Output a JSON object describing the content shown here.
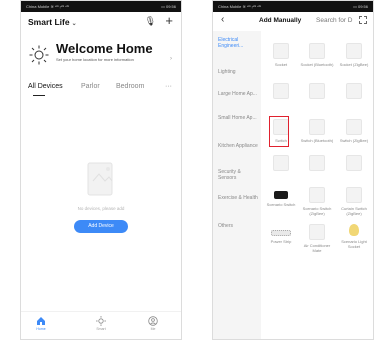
{
  "left_screen": {
    "status": {
      "left": "China Mobile ≋ ⁴ᴳ ᵢ⁴ᴳ ⁴ᴳ",
      "right": "▭ 09:56"
    },
    "home_title": "Smart Life",
    "chevron": "⌄",
    "mic": "🎙",
    "plus": "+",
    "welcome": "Welcome Home",
    "welcome_sub": "Set your home location for more information",
    "welcome_arrow": "›",
    "tabs": [
      "All Devices",
      "Parlor",
      "Bedroom"
    ],
    "more": "···",
    "empty_text": "No devices, please add",
    "add_device": "Add Device",
    "tabbar": [
      "Home",
      "Smart",
      "Me"
    ]
  },
  "right_screen": {
    "status": {
      "left": "China Mobile ≋ ⁴ᴳ ᵢ⁴ᴳ ⁴ᴳ",
      "right": "▭ 09:56"
    },
    "back": "‹",
    "title": "Add Manually",
    "search": "Search for D",
    "categories": [
      "Electrical Engineeri...",
      "Lighting",
      "Large Home Ap...",
      "Small Home Ap...",
      "Kitchen Appliance",
      "Security & Sensors",
      "Exercise & Health",
      "Others"
    ],
    "devices": [
      "Socket",
      "Socket (Bluetooth)",
      "Socket (ZigBee)",
      "",
      "",
      "",
      "Switch",
      "Switch (Bluetooth)",
      "Switch (ZigBee)",
      "",
      "",
      "",
      "Scenario Switch",
      "Scenario Switch (ZigBee)",
      "Curtain Switch (ZigBee)",
      "Power Strip",
      "Air Conditioner Mate",
      "Scenario Light Socket"
    ]
  },
  "colors": {
    "accent": "#3d8af7",
    "highlight": "#e0212e"
  }
}
